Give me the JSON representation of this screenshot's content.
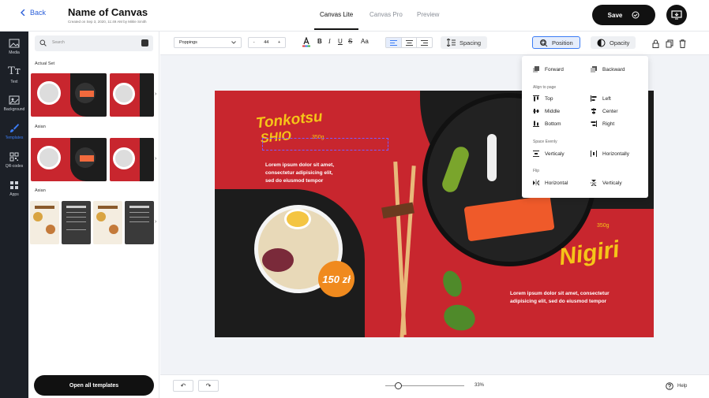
{
  "header": {
    "back_label": "Back",
    "title": "Name of Canvas",
    "subtitle": "Created on Sep 3, 2020, 11:49 AM by Mikle Smith",
    "tabs": [
      "Canvas Lite",
      "Canvas Pro",
      "Preview"
    ],
    "active_tab": "Canvas Lite",
    "save_label": "Save"
  },
  "rail": {
    "items": [
      {
        "label": "Media",
        "icon": "image-icon"
      },
      {
        "label": "Text",
        "icon": "text-icon"
      },
      {
        "label": "Background",
        "icon": "background-icon"
      },
      {
        "label": "Templates",
        "icon": "brush-icon"
      },
      {
        "label": "QR-codes",
        "icon": "qr-icon"
      },
      {
        "label": "Apps",
        "icon": "apps-icon"
      }
    ],
    "active": "Templates"
  },
  "templates": {
    "search_placeholder": "Search",
    "sections": [
      "Actual Set",
      "Asian",
      "Asian"
    ],
    "open_all_label": "Open all templates"
  },
  "toolbar": {
    "font": "Poppings",
    "size": "44",
    "minus": "-",
    "plus": "+",
    "bold": "B",
    "italic": "I",
    "underline": "U",
    "strike": "S",
    "case": "Aa",
    "spacing_label": "Spacing",
    "position_label": "Position",
    "opacity_label": "Opacity"
  },
  "position_menu": {
    "forward": "Forward",
    "backward": "Backward",
    "align_heading": "Align to page",
    "top": "Top",
    "left": "Left",
    "middle": "Middle",
    "center": "Center",
    "bottom": "Bottom",
    "right": "Right",
    "space_heading": "Space Evenly",
    "vertically": "Verticaly",
    "horizontally": "Horizontally",
    "flip_heading": "Flip",
    "flip_h": "Horizontal",
    "flip_v": "Verticaly"
  },
  "canvas": {
    "title1": "Tonkotsu",
    "title1b": "SHIO",
    "weight1": "350g",
    "body1": [
      "Lorem ipsum dolor sit amet,",
      "consectetur adipisicing elit,",
      "sed do eiusmod tempor"
    ],
    "price": "150 zł",
    "title2": "Nigiri",
    "weight2": "350g",
    "body2": [
      "Lorem ipsum dolor sit amet, consectetur",
      "adipisicing elit, sed do eiusmod tempor"
    ],
    "colors": {
      "red": "#c8262e",
      "dark": "#1c1c1c",
      "yellow": "#f5c518",
      "orange": "#e8730c"
    }
  },
  "bottom": {
    "undo": "↶",
    "redo": "↷",
    "zoom": "33%",
    "zoom_fraction": 0.16,
    "help_label": "Help"
  }
}
